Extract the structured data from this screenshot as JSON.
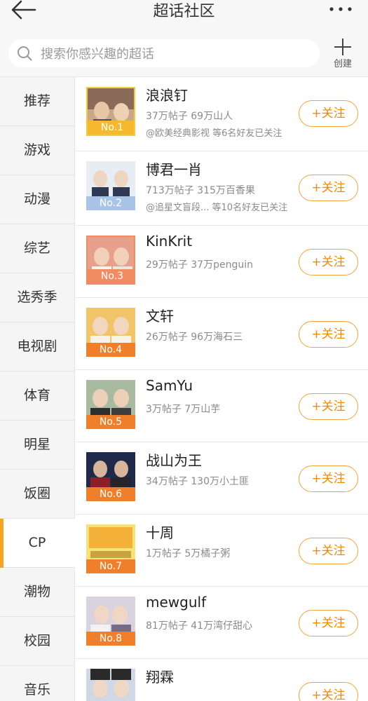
{
  "header": {
    "title": "超话社区",
    "back_icon": "arrow-left-icon",
    "more_icon": "more-dots-icon"
  },
  "search": {
    "placeholder": "搜索你感兴趣的超话",
    "icon": "search-icon"
  },
  "create": {
    "label": "创建",
    "icon": "plus-icon"
  },
  "sidebar": {
    "items": [
      {
        "label": "推荐"
      },
      {
        "label": "游戏"
      },
      {
        "label": "动漫"
      },
      {
        "label": "综艺"
      },
      {
        "label": "选秀季"
      },
      {
        "label": "电视剧"
      },
      {
        "label": "体育"
      },
      {
        "label": "明星"
      },
      {
        "label": "饭圈"
      },
      {
        "label": "CP"
      },
      {
        "label": "潮物"
      },
      {
        "label": "校园"
      },
      {
        "label": "音乐"
      }
    ],
    "active": "CP"
  },
  "colors": {
    "accent": "#f5a623",
    "follow": "#f08a00",
    "rank_gold": "#f5b82e",
    "rank_silver": "#a9c4e6",
    "rank_bronze": "#f28a62",
    "rank_default": "#f07f2c"
  },
  "follow_label": "+关注",
  "communities": [
    {
      "name": "浪浪钉",
      "stats": "37万帖子 69万山人",
      "friends": "@欧美经典影视 等6名好友已关注",
      "rank": "No.1"
    },
    {
      "name": "博君一肖",
      "stats": "713万帖子 315万百香果",
      "friends": "@追星文盲段... 等10名好友已关注",
      "rank": "No.2"
    },
    {
      "name": "KinKrit",
      "stats": "29万帖子 37万penguin",
      "friends": "",
      "rank": "No.3"
    },
    {
      "name": "文轩",
      "stats": "26万帖子 96万海石三",
      "friends": "",
      "rank": "No.4"
    },
    {
      "name": "SamYu",
      "stats": "3万帖子 7万山芋",
      "friends": "",
      "rank": "No.5"
    },
    {
      "name": "战山为王",
      "stats": "34万帖子 130万小土匪",
      "friends": "",
      "rank": "No.6"
    },
    {
      "name": "十周",
      "stats": "1万帖子 5万橘子粥",
      "friends": "",
      "rank": "No.7"
    },
    {
      "name": "mewgulf",
      "stats": "81万帖子 41万湾仔甜心",
      "friends": "",
      "rank": "No.8"
    },
    {
      "name": "翔霖",
      "stats": "",
      "friends": "",
      "rank": ""
    }
  ]
}
